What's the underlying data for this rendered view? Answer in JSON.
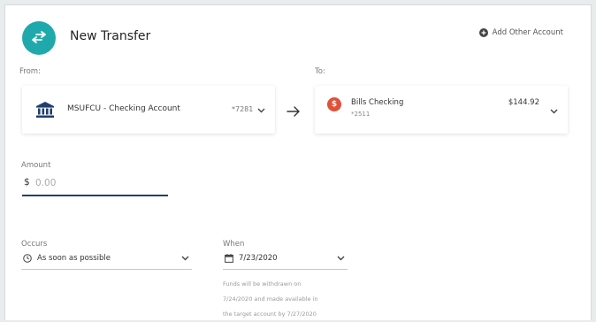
{
  "header": {
    "title": "New Transfer",
    "add_account_label": "Add Other Account",
    "accent_color": "#1fa9ad"
  },
  "from": {
    "label": "From:",
    "account_name": "MSUFCU - Checking Account",
    "account_mask": "*7281",
    "icon": "bank-icon"
  },
  "to": {
    "label": "To:",
    "account_name": "Bills Checking",
    "account_mask": "*2511",
    "balance": "$144.92",
    "badge_symbol": "$",
    "badge_color": "#e0513a"
  },
  "amount": {
    "label": "Amount",
    "currency_symbol": "$",
    "placeholder": "0.00",
    "underline_color": "#1f3f6e"
  },
  "occurs": {
    "label": "Occurs",
    "value": "As soon as possible",
    "icon": "clock-icon"
  },
  "when": {
    "label": "When",
    "value": "7/23/2020",
    "icon": "calendar-icon",
    "note_lines": [
      "Funds will be withdrawn on",
      "7/24/2020 and made available in",
      "the target account by 7/27/2020"
    ]
  }
}
